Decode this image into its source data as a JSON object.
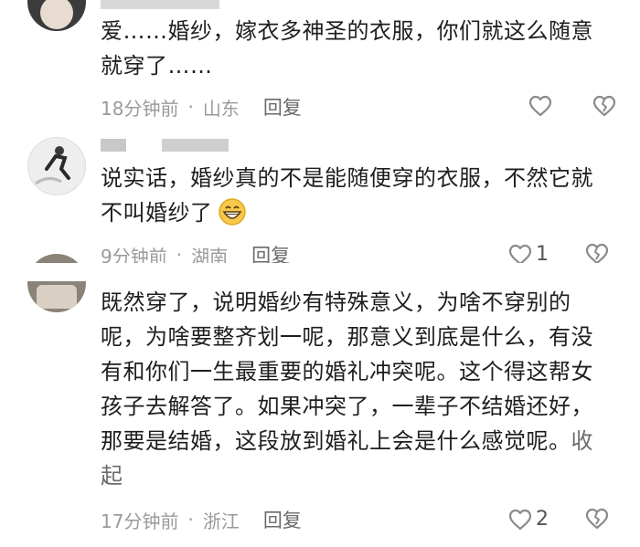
{
  "comments": [
    {
      "text": "爱……婚纱，嫁衣多神圣的衣服，你们就这么随意就穿了……",
      "time": "18分钟前",
      "dot": "·",
      "region": "山东",
      "reply": "回复",
      "likes": ""
    },
    {
      "text": "说实话，婚纱真的不是能随便穿的衣服，不然它就不叫婚纱了",
      "time": "9分钟前",
      "dot": "·",
      "region": "湖南",
      "reply": "回复",
      "likes": "1"
    },
    {
      "text": "既然穿了，说明婚纱有特殊意义，为啥不穿别的呢，为啥要整齐划一呢，那意义到底是什么，有没有和你们一生最重要的婚礼冲突呢。这个得这帮女孩子去解答了。如果冲突了，一辈子不结婚还好，那要是结婚，这段放到婚礼上会是什么感觉呢。",
      "collapse": "收起",
      "time": "17分钟前",
      "dot": "·",
      "region": "浙江",
      "reply": "回复",
      "likes": "2"
    }
  ],
  "icons": {
    "like": "heart-outline-icon",
    "dislike": "broken-heart-icon",
    "emoji": "grinning-face-emoji"
  },
  "colors": {
    "meta": "#9a9a9a",
    "icon": "#8a8a8a"
  }
}
